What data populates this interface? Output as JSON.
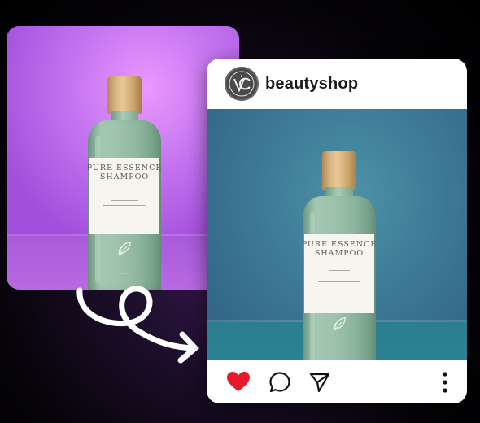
{
  "profile": {
    "username": "beautyshop",
    "avatar_icon": "monogram-logo-icon"
  },
  "product": {
    "line1": "PURE ESSENCE",
    "line2": "SHAMPOO"
  },
  "actions": {
    "like_icon": "heart-icon",
    "comment_icon": "comment-icon",
    "share_icon": "send-icon",
    "more_icon": "more-vertical-icon",
    "liked": true
  },
  "colors": {
    "like_red": "#e8192c",
    "source_bg": "#b45fe6",
    "post_bg": "#3e7c97"
  }
}
